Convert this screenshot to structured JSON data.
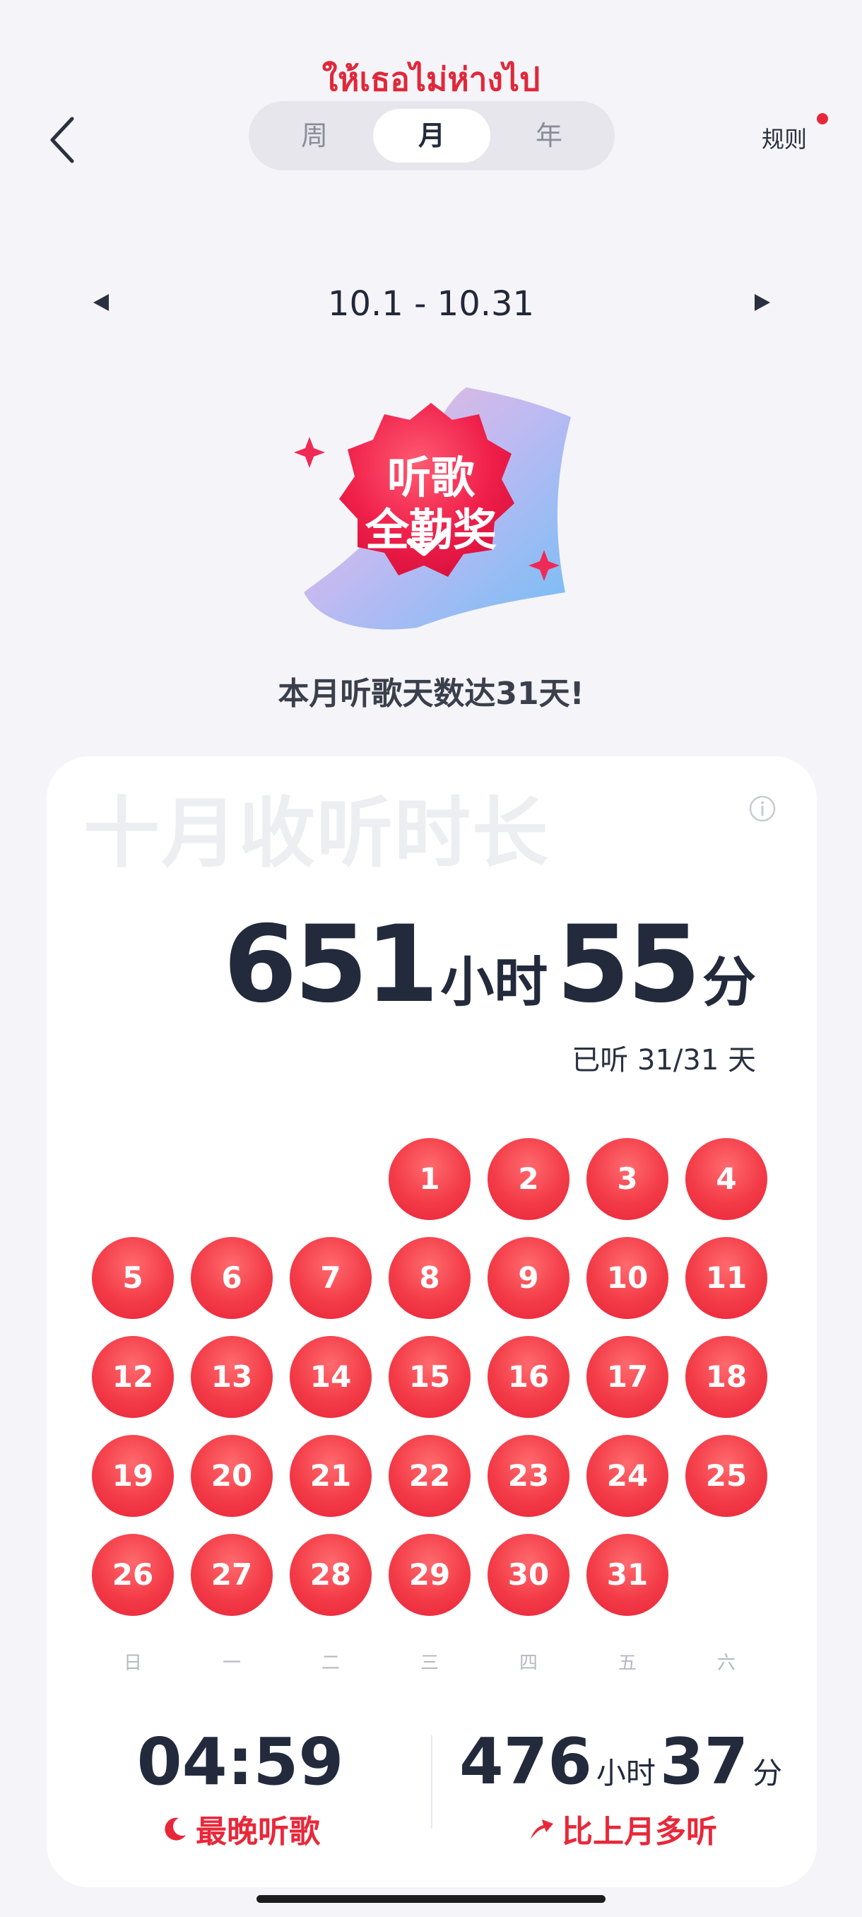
{
  "header": {
    "overlay_title": "ให้เธอไม่ห่างไป",
    "tabs": [
      {
        "label": "周",
        "active": false
      },
      {
        "label": "月",
        "active": true
      },
      {
        "label": "年",
        "active": false
      }
    ],
    "rules_label": "规则"
  },
  "date_nav": {
    "range": "10.1 - 10.31"
  },
  "badge": {
    "line1": "听歌",
    "line2": "全勤奖"
  },
  "achievement_text": "本月听歌天数达31天!",
  "card": {
    "title": "十月收听时长",
    "hours": "651",
    "hours_unit": "小时",
    "minutes": "55",
    "minutes_unit": "分",
    "listened_days": "已听 31/31 天"
  },
  "calendar": {
    "days": [
      "1",
      "2",
      "3",
      "4",
      "5",
      "6",
      "7",
      "8",
      "9",
      "10",
      "11",
      "12",
      "13",
      "14",
      "15",
      "16",
      "17",
      "18",
      "19",
      "20",
      "21",
      "22",
      "23",
      "24",
      "25",
      "26",
      "27",
      "28",
      "29",
      "30",
      "31"
    ],
    "weekdays": [
      "日",
      "一",
      "二",
      "三",
      "四",
      "五",
      "六"
    ],
    "first_weekday_index": 3
  },
  "stats": {
    "latest_time": "04:59",
    "latest_label": "最晚听歌",
    "more_hours": "476",
    "more_hours_unit": "小时",
    "more_minutes": "37",
    "more_minutes_unit": "分",
    "more_label": "比上月多听"
  },
  "colors": {
    "accent": "#e8283a",
    "background": "#f5f5f9",
    "text": "#232a3c"
  }
}
